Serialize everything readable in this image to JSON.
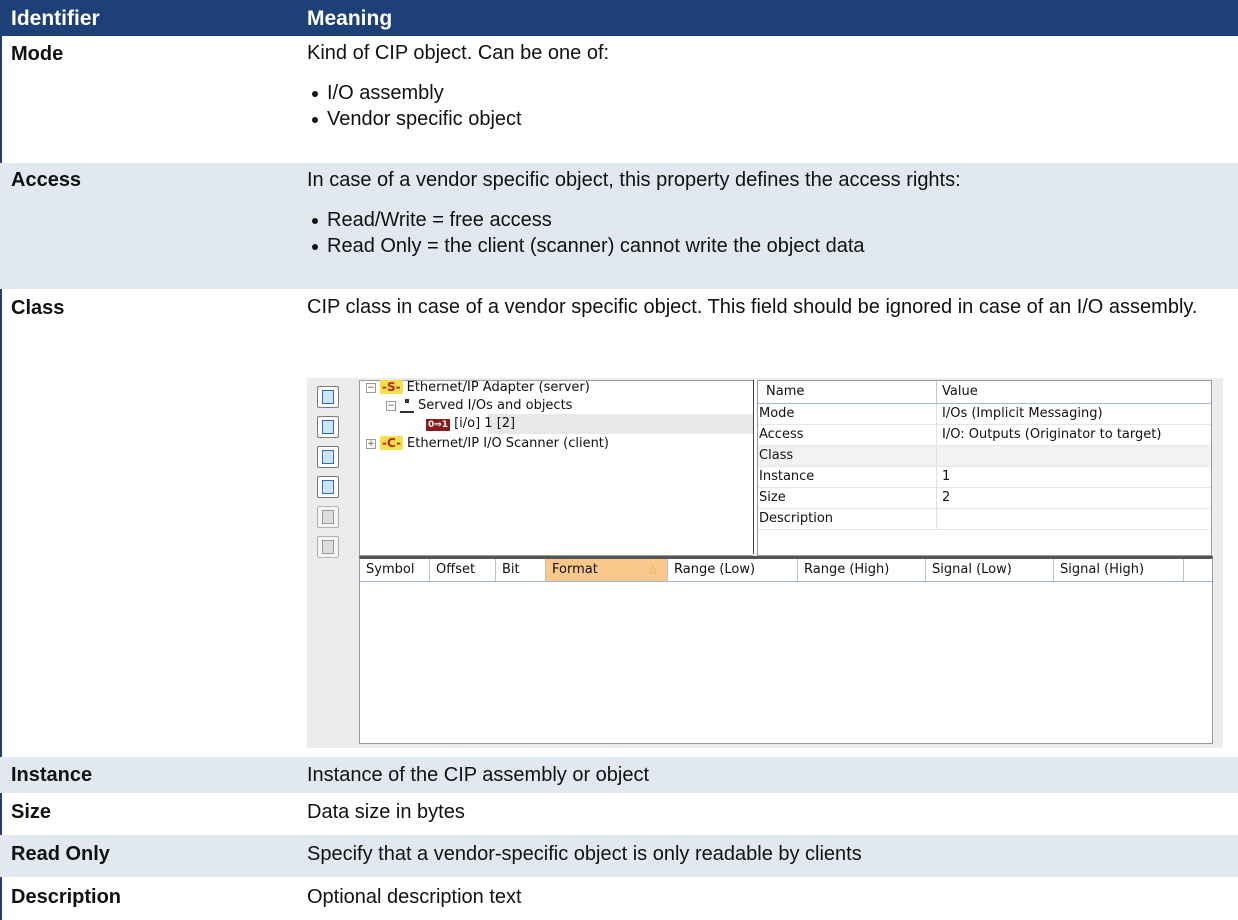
{
  "header": {
    "col1": "Identifier",
    "col2": "Meaning"
  },
  "rows": {
    "mode": {
      "id": "Mode",
      "text": "Kind of CIP object. Can be one of:",
      "items": [
        "I/O assembly",
        "Vendor specific object"
      ]
    },
    "access": {
      "id": "Access",
      "text": "In case of a vendor specific object, this property defines the access rights:",
      "items": [
        "Read/Write = free access",
        "Read Only = the client (scanner) cannot write the object data"
      ]
    },
    "class": {
      "id": "Class",
      "text": "CIP class in case of a vendor specific object. This field should be ignored in case of an I/O assembly."
    },
    "instance": {
      "id": "Instance",
      "text": "Instance of the CIP assembly or object"
    },
    "size": {
      "id": "Size",
      "text": "Data size in bytes"
    },
    "readonly": {
      "id": "Read Only",
      "text": "Specify that a vendor-specific object is only readable by clients"
    },
    "description": {
      "id": "Description",
      "text": "Optional description text"
    }
  },
  "screenshot": {
    "tree": {
      "server_badge": "-S-",
      "server": "Ethernet/IP Adapter (server)",
      "served": "Served I/Os and objects",
      "io_icon": "0⇒1",
      "io_item": "[i/o] 1 [2]",
      "client_badge": "-C-",
      "client": "Ethernet/IP I/O Scanner (client)"
    },
    "props": {
      "col_name": "Name",
      "col_value": "Value",
      "rows": [
        {
          "name": "Mode",
          "value": "I/Os (Implicit Messaging)"
        },
        {
          "name": "Access",
          "value": "I/O: Outputs (Originator to target)"
        },
        {
          "name": "Class",
          "value": ""
        },
        {
          "name": "Instance",
          "value": "1"
        },
        {
          "name": "Size",
          "value": "2"
        },
        {
          "name": "Description",
          "value": ""
        }
      ]
    },
    "grid_columns": [
      "Symbol",
      "Offset",
      "Bit",
      "Format",
      "Range (Low)",
      "Range (High)",
      "Signal (Low)",
      "Signal (High)"
    ],
    "sorted_column": "Format",
    "sort_arrow": "△",
    "toolbar_icons": [
      "tree-view-icon",
      "network-icon",
      "add-object-icon",
      "edit-icon",
      "import-icon",
      "export-icon"
    ]
  }
}
